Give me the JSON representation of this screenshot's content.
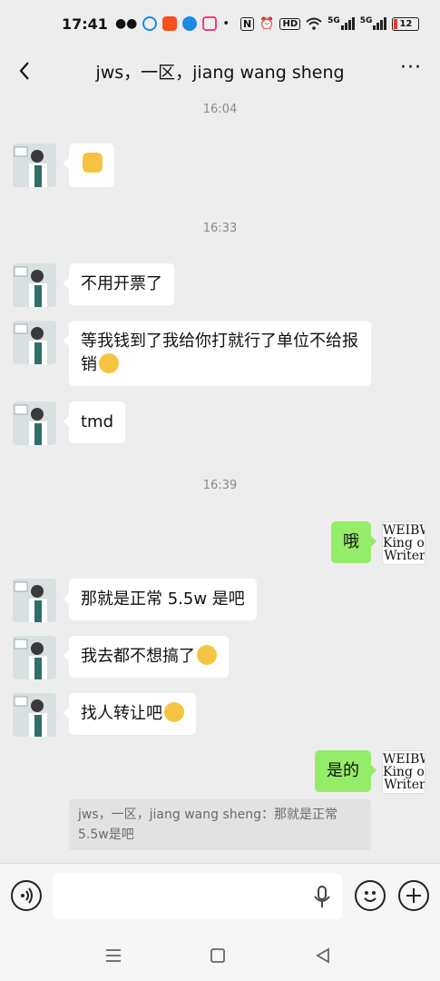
{
  "status_bar": {
    "time": "17:41",
    "network_label": "HD",
    "signal_1": "5G",
    "signal_2": "5G",
    "battery": "12"
  },
  "header": {
    "title": "jws，一区，jiang wang sheng",
    "back_icon": "chevron-left-icon",
    "more_icon": "more-icon"
  },
  "messages": [
    {
      "type": "timestamp",
      "text": "16:04"
    },
    {
      "type": "message",
      "side": "left",
      "text": "",
      "emoji": "handshake"
    },
    {
      "type": "timestamp",
      "text": "16:33"
    },
    {
      "type": "message",
      "side": "left",
      "text": "不用开票了"
    },
    {
      "type": "message",
      "side": "left",
      "text": "等我钱到了我给你打就行了单位不给报销",
      "emoji": "frown"
    },
    {
      "type": "message",
      "side": "left",
      "text": "tmd"
    },
    {
      "type": "timestamp",
      "text": "16:39"
    },
    {
      "type": "message",
      "side": "right",
      "text": "哦"
    },
    {
      "type": "message",
      "side": "left",
      "text": "那就是正常 5.5w 是吧"
    },
    {
      "type": "message",
      "side": "left",
      "text": "我去都不想搞了",
      "emoji": "laugh-tears"
    },
    {
      "type": "message",
      "side": "left",
      "text": "找人转让吧",
      "emoji": "crying"
    },
    {
      "type": "message",
      "side": "right",
      "text": "是的"
    }
  ],
  "self_avatar_text": "WEIBW\nKing of\nWriter",
  "quote": {
    "text": "jws，一区，jiang wang sheng：那就是正常5.5w是吧"
  },
  "input": {
    "value": "",
    "placeholder": ""
  },
  "colors": {
    "background": "#ededed",
    "self_bubble": "#95ec69",
    "other_bubble": "#ffffff"
  }
}
